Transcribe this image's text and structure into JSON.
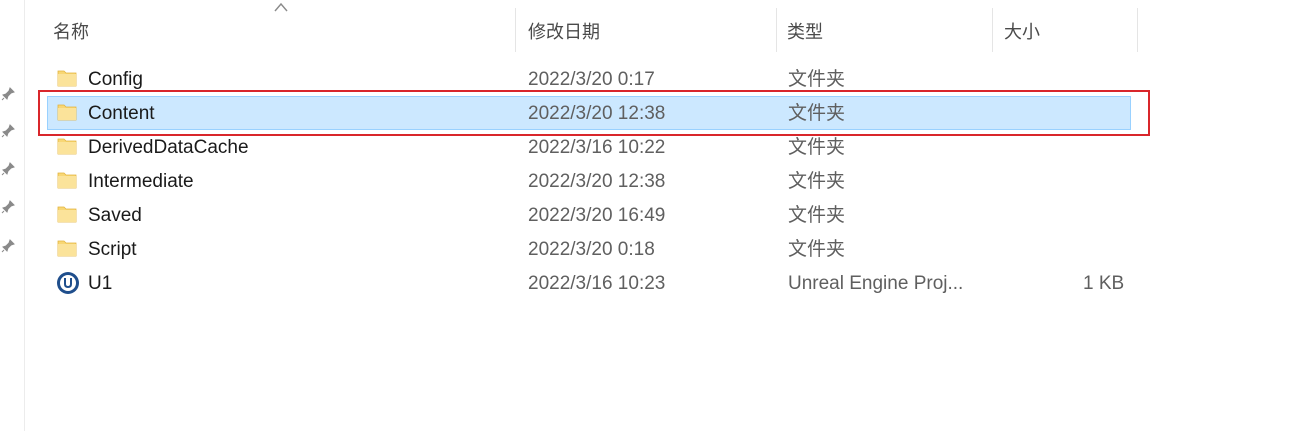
{
  "columns": {
    "name": "名称",
    "modified": "修改日期",
    "type": "类型",
    "size": "大小"
  },
  "files": [
    {
      "name": "Config",
      "modified": "2022/3/20 0:17",
      "type": "文件夹",
      "size": "",
      "icon": "folder-icon"
    },
    {
      "name": "Content",
      "modified": "2022/3/20 12:38",
      "type": "文件夹",
      "size": "",
      "icon": "folder-icon",
      "selected": true
    },
    {
      "name": "DerivedDataCache",
      "modified": "2022/3/16 10:22",
      "type": "文件夹",
      "size": "",
      "icon": "folder-icon"
    },
    {
      "name": "Intermediate",
      "modified": "2022/3/20 12:38",
      "type": "文件夹",
      "size": "",
      "icon": "folder-icon"
    },
    {
      "name": "Saved",
      "modified": "2022/3/20 16:49",
      "type": "文件夹",
      "size": "",
      "icon": "folder-icon"
    },
    {
      "name": "Script",
      "modified": "2022/3/20 0:18",
      "type": "文件夹",
      "size": "",
      "icon": "folder-icon"
    },
    {
      "name": "U1",
      "modified": "2022/3/16 10:23",
      "type": "Unreal Engine Proj...",
      "size": "1 KB",
      "icon": "unreal-engine-icon"
    }
  ],
  "colors": {
    "selection_bg": "#cce8ff",
    "selection_border": "#99d1ff",
    "highlight": "#d9262b",
    "folder": "#f8d775"
  }
}
